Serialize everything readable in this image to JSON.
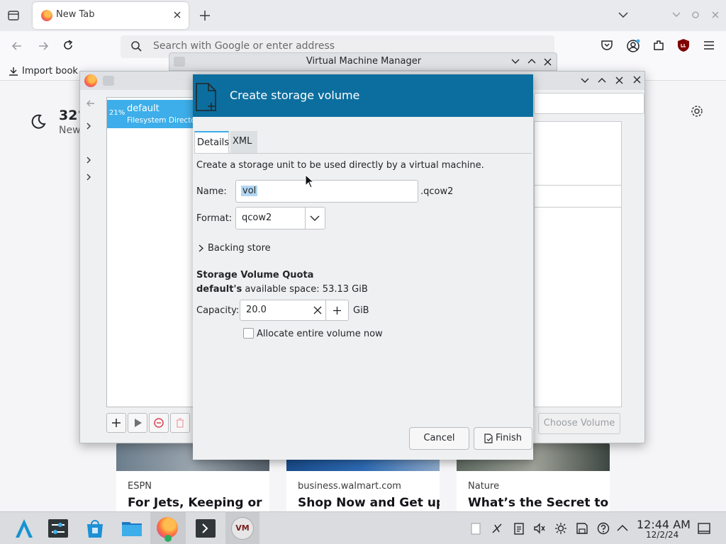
{
  "firefox": {
    "tab_title": "New Tab",
    "url_placeholder": "Search with Google or enter address",
    "bookmark_label": "Import book",
    "weather_temp": "32°",
    "weather_sub": "New",
    "news": [
      {
        "source": "ESPN",
        "headline": "For Jets, Keeping or"
      },
      {
        "source": "business.walmart.com",
        "headline": "Shop Now and Get up"
      },
      {
        "source": "Nature",
        "headline": "What’s the Secret to"
      }
    ]
  },
  "vmm_window": {
    "title": "Virtual Machine Manager"
  },
  "pools_window": {
    "pool": {
      "usage": "21%",
      "name": "default",
      "type": "Filesystem Directory"
    },
    "choose_volume_label": "Choose Volume"
  },
  "dialog": {
    "title": "Create storage volume",
    "tabs": [
      "Details",
      "XML"
    ],
    "description": "Create a storage unit to be used directly by a virtual machine.",
    "name_label": "Name:",
    "name_value": "vol",
    "name_suffix": ".qcow2",
    "format_label": "Format:",
    "format_value": "qcow2",
    "backing_store_label": "Backing store",
    "quota_heading": "Storage Volume Quota",
    "pool_owner": "default's",
    "available_space_text": "available space: 53.13 GiB",
    "capacity_label": "Capacity:",
    "capacity_value": "20.0",
    "capacity_unit": "GiB",
    "allocate_label": "Allocate entire volume now",
    "allocate_checked": false,
    "cancel_label": "Cancel",
    "finish_label": "Finish",
    "header_color": "#0c6e9e"
  },
  "taskbar": {
    "time": "12:44 AM",
    "date": "12/2/24",
    "apps": [
      "app-launcher-icon",
      "system-settings-icon",
      "discover-store-icon",
      "file-manager-icon",
      "firefox-icon",
      "terminal-icon",
      "virt-manager-icon"
    ],
    "tray": [
      "clipboard-icon",
      "kde-connect-icon",
      "notes-icon",
      "volume-muted-icon",
      "brightness-icon",
      "save-icon",
      "help-icon",
      "tray-expand-icon",
      "show-desktop-icon"
    ]
  }
}
